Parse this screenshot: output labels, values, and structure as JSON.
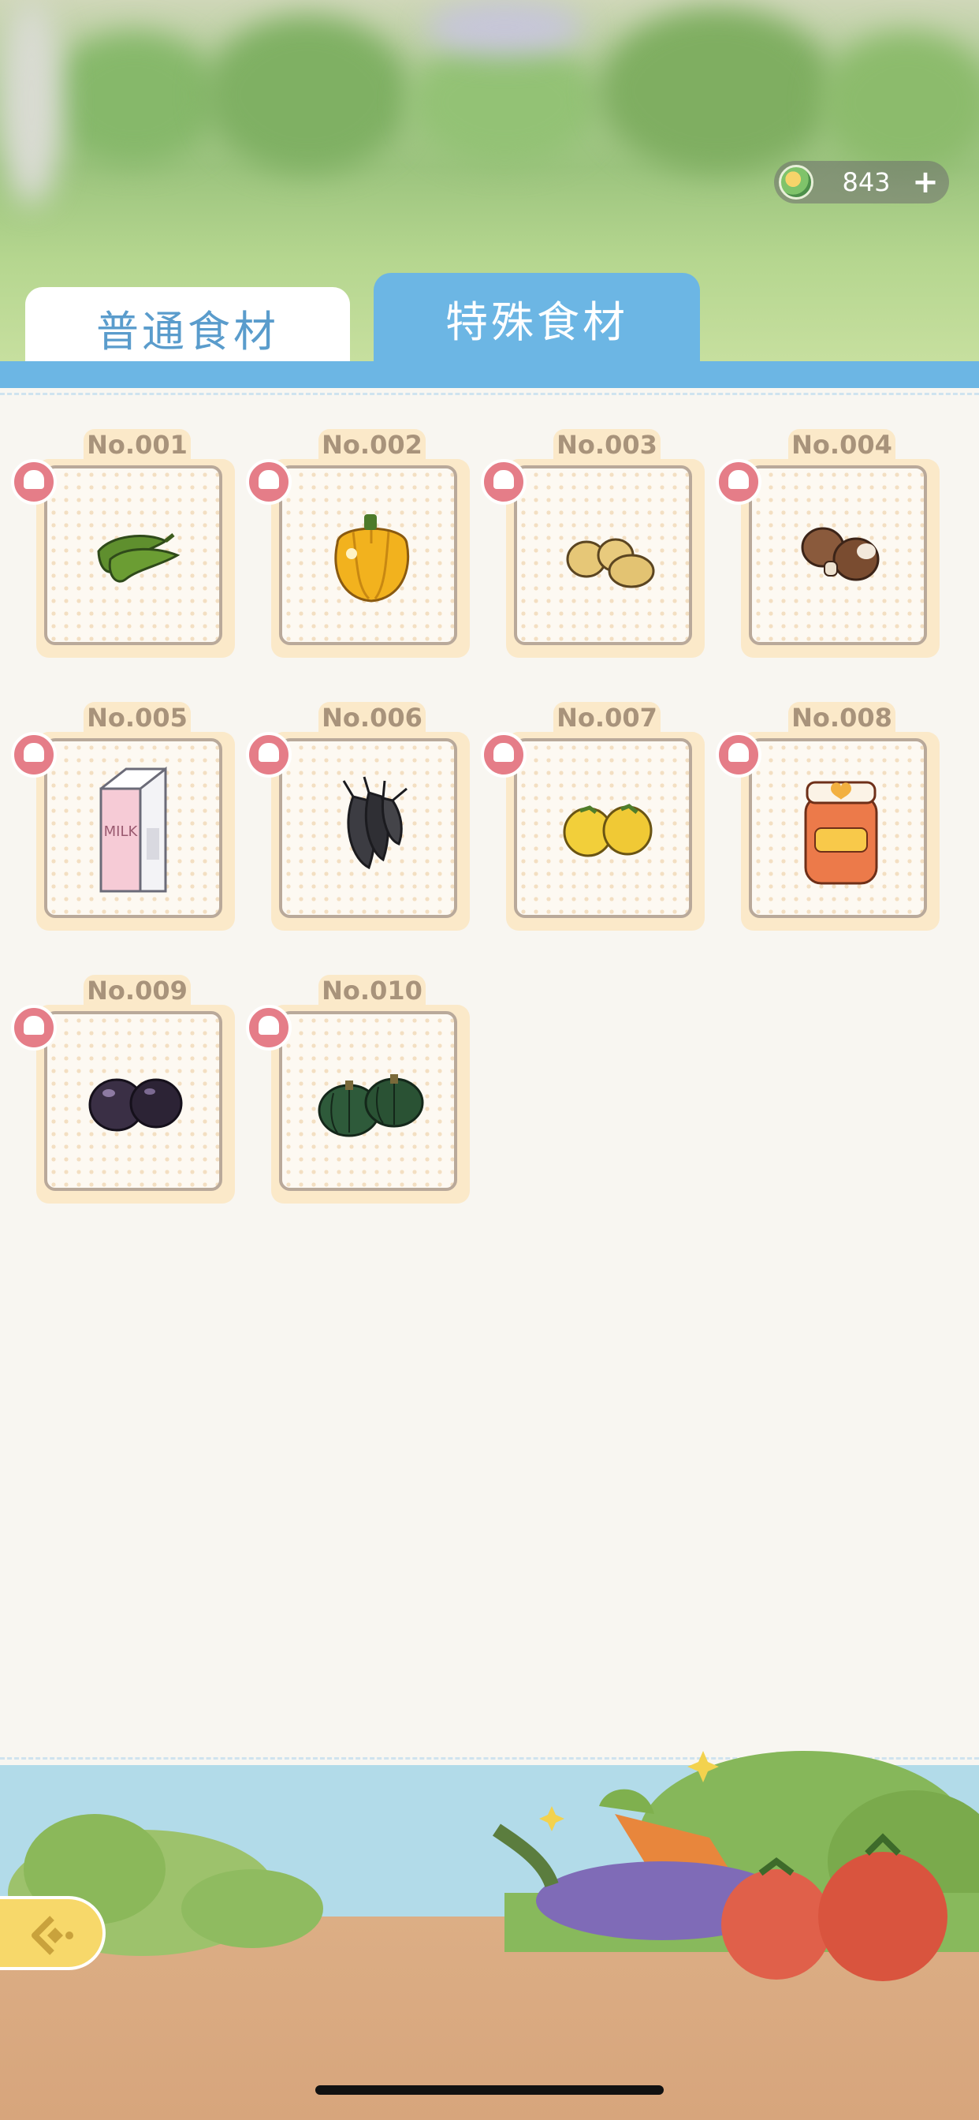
{
  "currency": {
    "value": "843",
    "plus_label": "+"
  },
  "tabs": [
    {
      "label": "普通食材",
      "active": false
    },
    {
      "label": "特殊食材",
      "active": true
    }
  ],
  "items": [
    {
      "no": "No.001",
      "icon": "green-pepper-icon"
    },
    {
      "no": "No.002",
      "icon": "bell-pepper-icon"
    },
    {
      "no": "No.003",
      "icon": "potato-icon"
    },
    {
      "no": "No.004",
      "icon": "mushroom-icon"
    },
    {
      "no": "No.005",
      "icon": "milk-carton-icon"
    },
    {
      "no": "No.006",
      "icon": "shrimp-icon"
    },
    {
      "no": "No.007",
      "icon": "yellow-tomato-icon"
    },
    {
      "no": "No.008",
      "icon": "jam-jar-icon"
    },
    {
      "no": "No.009",
      "icon": "eggplant-icon"
    },
    {
      "no": "No.010",
      "icon": "pumpkin-icon"
    }
  ],
  "milk_text": "MILK",
  "colors": {
    "tab_active": "#6cb6e4",
    "tab_inactive_text": "#5a9ccc",
    "card_frame": "#fbe9c9",
    "chef_badge": "#e57d88",
    "back_button": "#f7d86a"
  }
}
